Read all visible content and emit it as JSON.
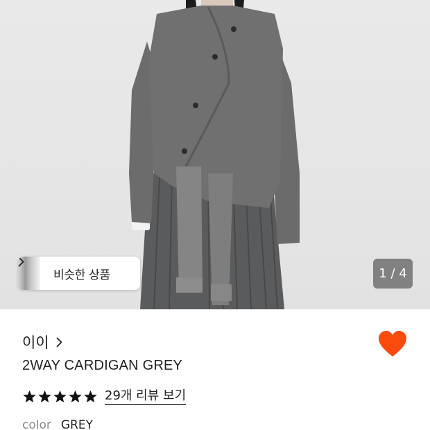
{
  "photo": {
    "similar_products_label": "비슷한 상품",
    "image_counter": "1 / 4"
  },
  "product": {
    "brand": "이이",
    "name": "2WAY CARDIGAN GREY",
    "rating_stars": 5,
    "review_link": "29개 리뷰 보기",
    "color_label": "color",
    "color_value": "GREY",
    "wishlisted": true
  },
  "colors": {
    "heart": "#fa4a0c",
    "star": "#111111",
    "counter_bg": "#464646"
  },
  "icons": [
    "chevron-right-icon",
    "heart-icon",
    "star-icon"
  ]
}
